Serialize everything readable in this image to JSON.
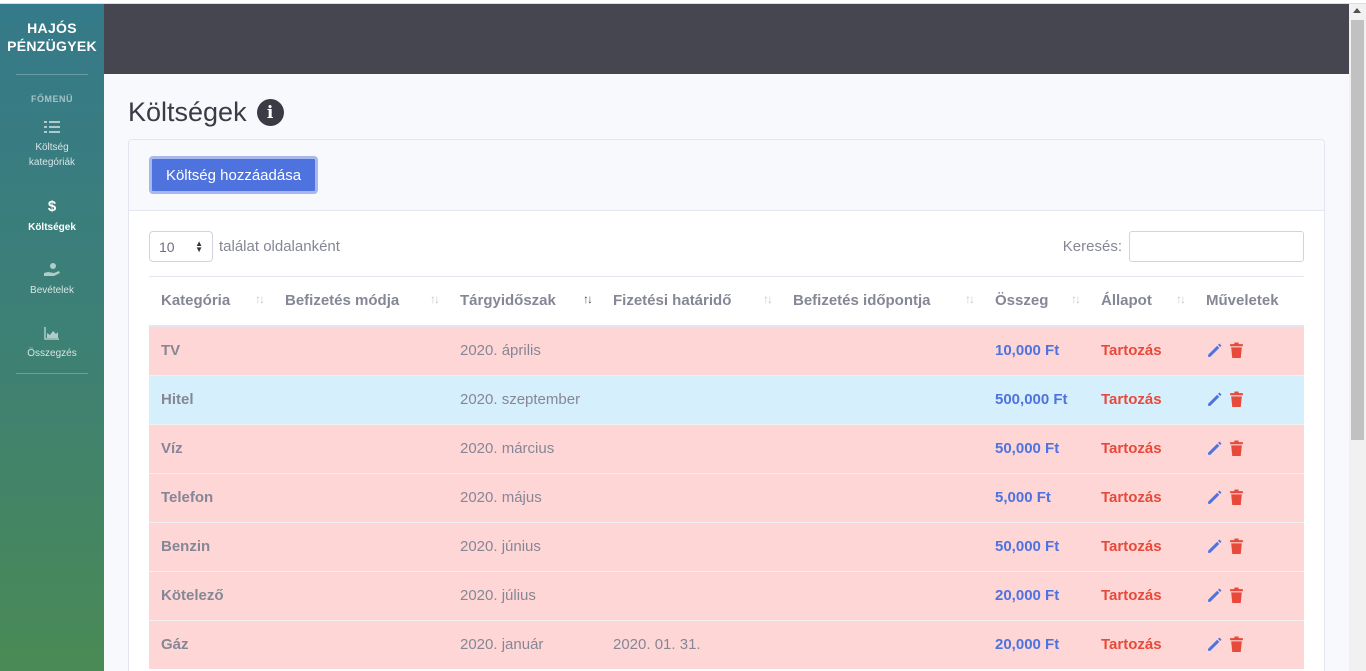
{
  "brand": {
    "line1": "HAJÓS",
    "line2": "PÉNZÜGYEK"
  },
  "sidebar": {
    "heading": "FŐMENÜ",
    "items": [
      {
        "label_1": "Költség",
        "label_2": "kategóriák",
        "icon": "list-icon",
        "active": false
      },
      {
        "label_1": "Költségek",
        "icon": "dollar-icon",
        "active": true
      },
      {
        "label_1": "Bevételek",
        "icon": "hand-holding-icon",
        "active": false
      },
      {
        "label_1": "Összegzés",
        "icon": "area-chart-icon",
        "active": false
      }
    ]
  },
  "page": {
    "title": "Költségek",
    "info_icon": "info-circle-icon"
  },
  "toolbar": {
    "add_label": "Költség hozzáadása"
  },
  "table_controls": {
    "page_length": "10",
    "page_length_suffix": "találat oldalanként",
    "search_label": "Keresés:",
    "search_value": ""
  },
  "table": {
    "columns": [
      "Kategória",
      "Befizetés módja",
      "Tárgyidőszak",
      "Fizetési határidő",
      "Befizetés időpontja",
      "Összeg",
      "Állapot",
      "Műveletek"
    ],
    "rows": [
      {
        "category": "TV",
        "method": "",
        "period": "2020. április",
        "deadline": "",
        "paid_at": "",
        "amount": "10,000 Ft",
        "status": "Tartozás",
        "style": "debt"
      },
      {
        "category": "Hitel",
        "method": "",
        "period": "2020. szeptember",
        "deadline": "",
        "paid_at": "",
        "amount": "500,000 Ft",
        "status": "Tartozás",
        "style": "info"
      },
      {
        "category": "Víz",
        "method": "",
        "period": "2020. március",
        "deadline": "",
        "paid_at": "",
        "amount": "50,000 Ft",
        "status": "Tartozás",
        "style": "debt"
      },
      {
        "category": "Telefon",
        "method": "",
        "period": "2020. május",
        "deadline": "",
        "paid_at": "",
        "amount": "5,000 Ft",
        "status": "Tartozás",
        "style": "debt"
      },
      {
        "category": "Benzin",
        "method": "",
        "period": "2020. június",
        "deadline": "",
        "paid_at": "",
        "amount": "50,000 Ft",
        "status": "Tartozás",
        "style": "debt"
      },
      {
        "category": "Kötelező",
        "method": "",
        "period": "2020. július",
        "deadline": "",
        "paid_at": "",
        "amount": "20,000 Ft",
        "status": "Tartozás",
        "style": "debt"
      },
      {
        "category": "Gáz",
        "method": "",
        "period": "2020. január",
        "deadline": "2020. 01. 31.",
        "paid_at": "",
        "amount": "20,000 Ft",
        "status": "Tartozás",
        "style": "debt"
      }
    ]
  },
  "colors": {
    "accent": "#4e73df",
    "danger": "#e74a3b",
    "debt_row": "#ffd6d6",
    "info_row": "#d6effc",
    "topbar": "#45464f"
  }
}
